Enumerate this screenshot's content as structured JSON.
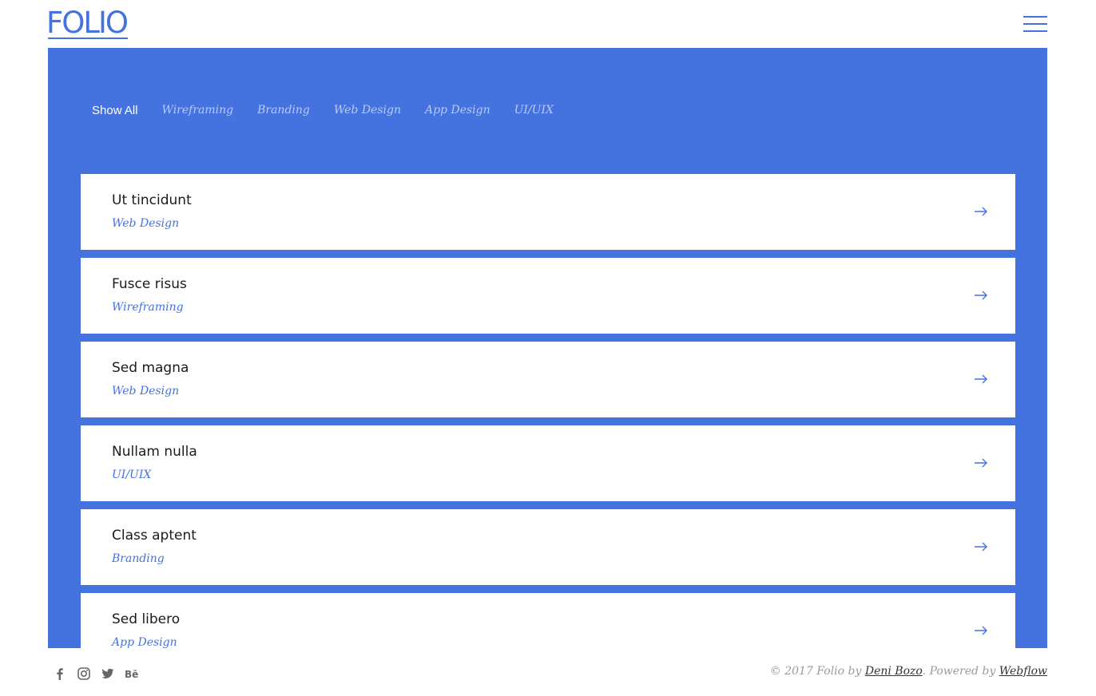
{
  "header": {
    "logo": "FOLIO",
    "menu_icon": "hamburger-menu-icon"
  },
  "filters": [
    "Show All",
    "Wireframing",
    "Branding",
    "Web Design",
    "App Design",
    "UI/UIX"
  ],
  "projects": [
    {
      "title": "Ut tincidunt",
      "category": "Web Design"
    },
    {
      "title": "Fusce risus",
      "category": "Wireframing"
    },
    {
      "title": "Sed magna",
      "category": "Web Design"
    },
    {
      "title": "Nullam nulla",
      "category": "UI/UIX"
    },
    {
      "title": "Class aptent",
      "category": "Branding"
    },
    {
      "title": "Sed libero",
      "category": "App Design"
    }
  ],
  "footer": {
    "social_icons": [
      "facebook-icon",
      "instagram-icon",
      "twitter-icon",
      "behance-icon"
    ],
    "copyright_prefix": "© 2017 Folio by ",
    "author": "Deni Bozo",
    "powered_prefix": ". Powered by ",
    "platform": "Webflow"
  },
  "colors": {
    "accent": "#4472de",
    "filter_inactive": "#b9cbf6",
    "card_bg": "#ffffff",
    "title_text": "#1b1b1b"
  }
}
